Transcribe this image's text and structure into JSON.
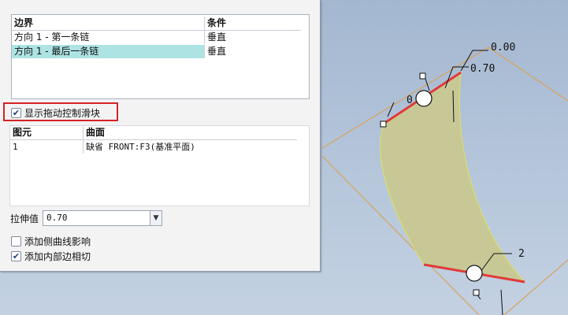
{
  "boundaries": {
    "headers": {
      "boundary": "边界",
      "condition": "条件"
    },
    "rows": [
      {
        "boundary": "方向 1 - 第一条链",
        "condition": "垂直"
      },
      {
        "boundary": "方向 1 - 最后一条链",
        "condition": "垂直"
      }
    ],
    "selected_row": 1
  },
  "drag_handles": {
    "label": "显示拖动控制滑块",
    "checked": true
  },
  "elements": {
    "headers": {
      "element": "图元",
      "surface": "曲面"
    },
    "rows": [
      {
        "element": "1",
        "surface": "缺省 FRONT:F3(基准平面)"
      }
    ]
  },
  "stretch": {
    "label": "拉伸值",
    "value": "0.70"
  },
  "options": [
    {
      "label": "添加侧曲线影响",
      "checked": false
    },
    {
      "label": "添加内部边相切",
      "checked": true
    }
  ],
  "viewport": {
    "labels": {
      "top_value": "0.00",
      "right_value": "0.70",
      "left_value": "0",
      "bottom_value": "2"
    },
    "colors": {
      "surface": "#c7c896",
      "edge_highlight": "#e23a3a",
      "datum": "#d8a25a",
      "background": "#b4c5da"
    }
  }
}
